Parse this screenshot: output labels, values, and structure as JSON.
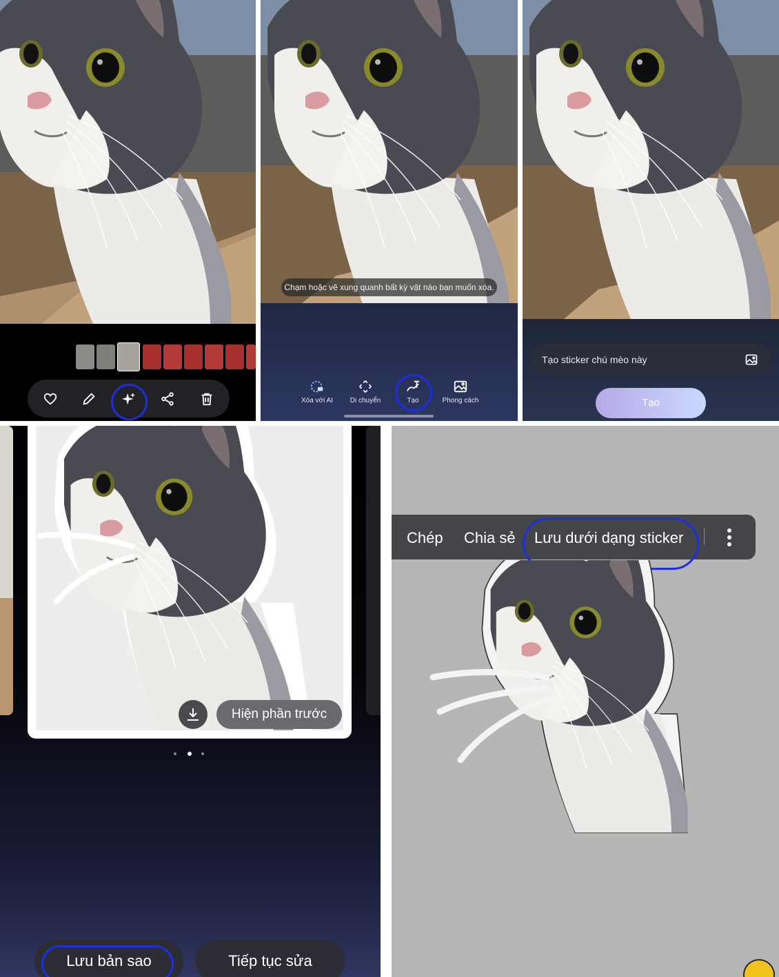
{
  "panel1": {
    "toolbar": {
      "favorite_icon": "heart-icon",
      "edit_icon": "pencil-icon",
      "ai_icon": "sparkle-icon",
      "share_icon": "share-icon",
      "delete_icon": "trash-icon"
    }
  },
  "panel2": {
    "hint": "Chạm hoặc vẽ xung quanh bất kỳ vật nào bạn muốn xóa.",
    "tools": [
      {
        "label": "Xóa với AI",
        "icon": "eraser-icon"
      },
      {
        "label": "Di chuyển",
        "icon": "move-icon"
      },
      {
        "label": "Tạo",
        "icon": "draw-icon"
      },
      {
        "label": "Phong cách",
        "icon": "style-icon"
      }
    ]
  },
  "panel3": {
    "prompt_value": "Tạo sticker chú mèo này",
    "image_icon": "image-icon",
    "create_label": "Tạo"
  },
  "panel4": {
    "download_icon": "download-icon",
    "preview_label": "Hiện phần trước",
    "page_dots": {
      "count": 3,
      "active": 2
    },
    "save_copy_label": "Lưu bản sao",
    "continue_edit_label": "Tiếp tục sửa"
  },
  "panel5": {
    "menu": {
      "copy": "Chép",
      "share": "Chia sẻ",
      "save_sticker": "Lưu dưới dạng sticker",
      "more_icon": "more-vertical-icon"
    }
  },
  "colors": {
    "highlight_ring": "#1d2de0",
    "create_button_gradient": [
      "#b6a9e6",
      "#c9d9ff"
    ]
  }
}
